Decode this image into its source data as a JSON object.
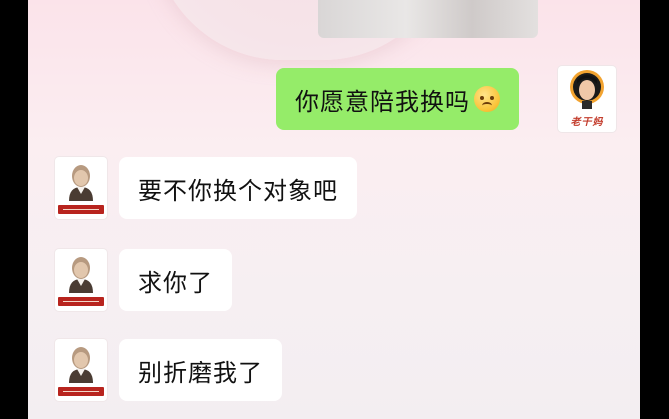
{
  "chat": {
    "messages": [
      {
        "sender": "self",
        "text": "你愿意陪我换吗",
        "emoji": "sad-face-icon"
      },
      {
        "sender": "other",
        "text": "要不你换个对象吧"
      },
      {
        "sender": "other",
        "text": "求你了"
      },
      {
        "sender": "other",
        "text": "别折磨我了"
      }
    ],
    "self_avatar_logo_text": "老干妈"
  },
  "colors": {
    "outgoing_bubble": "#95ec69",
    "incoming_bubble": "#ffffff",
    "background_top": "#fbe3ea",
    "background_bottom": "#f3eef1"
  }
}
